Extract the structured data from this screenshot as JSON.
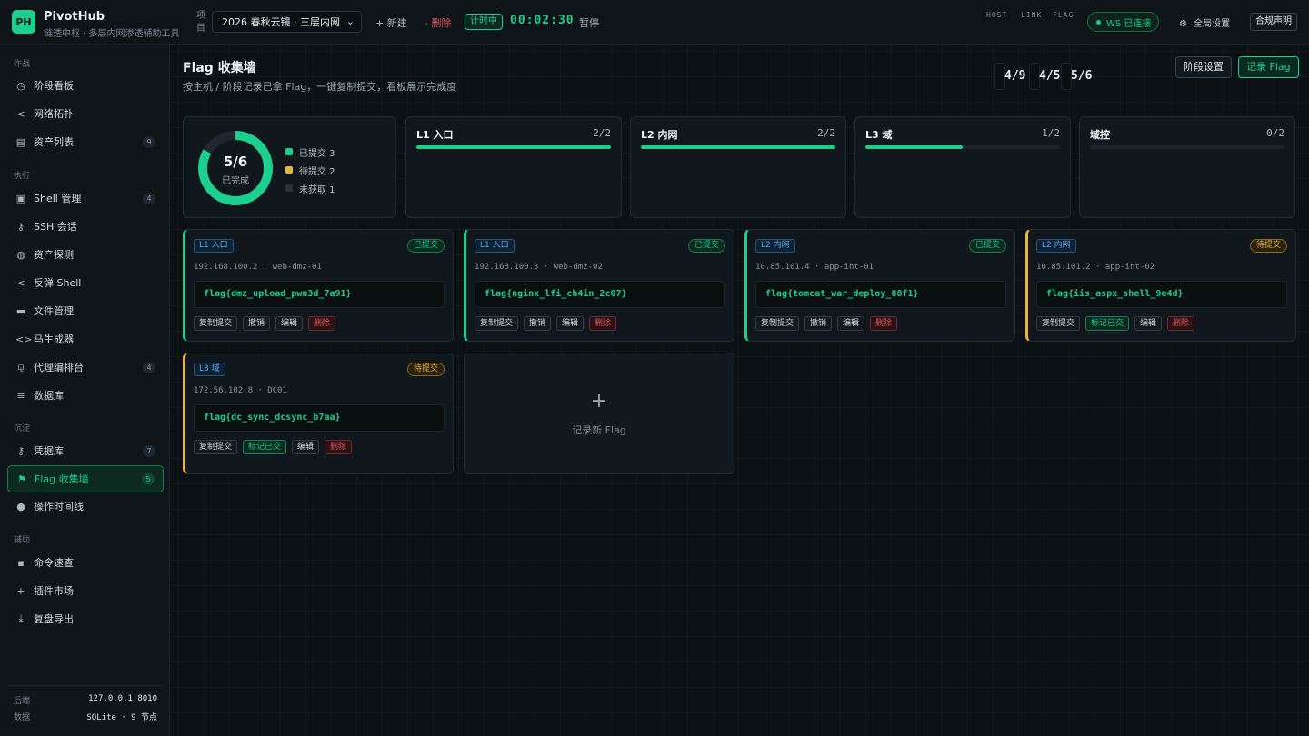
{
  "app": {
    "logo": "PH",
    "name": "PivotHub",
    "subtitle": "链透中枢 · 多层内网渗透辅助工具"
  },
  "topbar": {
    "project_label": "项目",
    "project_value": "2026 春秋云镜 · 三层内网",
    "new_label": "+ 新建",
    "delete_label": "- 删除",
    "timer_badge": "计时中",
    "timer_value": "00:02:30",
    "pause_label": "暂停",
    "stats": [
      {
        "label": "HOST",
        "value": "4/9"
      },
      {
        "label": "LINK",
        "value": "4/5"
      },
      {
        "label": "FLAG",
        "value": "5/6"
      }
    ],
    "ws_status": "WS 已连接",
    "global_settings": "全局设置",
    "compliance": "合规声明"
  },
  "sidebar": {
    "sections": [
      {
        "title": "作战",
        "items": [
          {
            "label": "阶段看板",
            "icon": "clock-icon"
          },
          {
            "label": "网络拓扑",
            "icon": "share-icon"
          },
          {
            "label": "资产列表",
            "icon": "server-icon",
            "count": "9"
          }
        ]
      },
      {
        "title": "执行",
        "items": [
          {
            "label": "Shell 管理",
            "icon": "terminal-icon",
            "count": "4"
          },
          {
            "label": "SSH 会话",
            "icon": "key-icon"
          },
          {
            "label": "资产探测",
            "icon": "globe-icon"
          },
          {
            "label": "反弹 Shell",
            "icon": "share-icon"
          },
          {
            "label": "文件管理",
            "icon": "folder-icon"
          },
          {
            "label": "马生成器",
            "icon": "code-icon"
          },
          {
            "label": "代理编排台",
            "icon": "sitemap-icon",
            "count": "4"
          },
          {
            "label": "数据库",
            "icon": "database-icon"
          }
        ]
      },
      {
        "title": "沉淀",
        "items": [
          {
            "label": "凭据库",
            "icon": "key-icon",
            "count": "7"
          },
          {
            "label": "Flag 收集墙",
            "icon": "flag-icon",
            "count": "5",
            "active": true
          },
          {
            "label": "操作时间线",
            "icon": "circle-icon"
          }
        ]
      },
      {
        "title": "辅助",
        "items": [
          {
            "label": "命令速查",
            "icon": "note-icon"
          },
          {
            "label": "插件市场",
            "icon": "plus-icon"
          },
          {
            "label": "复盘导出",
            "icon": "download-icon"
          }
        ]
      }
    ],
    "footer": {
      "backend_label": "后端",
      "backend_value": "127.0.0.1:8010",
      "data_label": "数据",
      "data_value": "SQLite · 9 节点"
    }
  },
  "main": {
    "title": "Flag 收集墙",
    "subtitle": "按主机 / 阶段记录已拿 Flag，一键复制提交，看板展示完成度",
    "btn_stage": "阶段设置",
    "btn_record": "记录 Flag",
    "summary": {
      "value": "5/6",
      "caption": "已完成",
      "legend": [
        {
          "label": "已提交 3",
          "color": "#1ccf8f"
        },
        {
          "label": "待提交 2",
          "color": "#e8b341"
        },
        {
          "label": "未获取 1",
          "color": "#2a343b"
        }
      ],
      "submitted": 3,
      "pending": 2,
      "missing": 1,
      "total": 6
    },
    "stages": [
      {
        "name": "L1 入口",
        "ratio": "2/2",
        "progress": 1.0
      },
      {
        "name": "L2 内网",
        "ratio": "2/2",
        "progress": 1.0
      },
      {
        "name": "L3 域",
        "ratio": "1/2",
        "progress": 0.5
      },
      {
        "name": "域控",
        "ratio": "0/2",
        "progress": 0
      }
    ],
    "flags": [
      {
        "level": "L1 入口",
        "status": "已提交",
        "state": "ok",
        "meta": "192.168.100.2 · web-dmz-01",
        "value": "flag{dmz_upload_pwn3d_7a91}",
        "actions": [
          "复制提交",
          "撤销",
          "编辑",
          "删除"
        ]
      },
      {
        "level": "L1 入口",
        "status": "已提交",
        "state": "ok",
        "meta": "192.168.100.3 · web-dmz-02",
        "value": "flag{nginx_lfi_ch4in_2c07}",
        "actions": [
          "复制提交",
          "撤销",
          "编辑",
          "删除"
        ]
      },
      {
        "level": "L2 内网",
        "status": "已提交",
        "state": "ok",
        "meta": "10.85.101.4 · app-int-01",
        "value": "flag{tomcat_war_deploy_88f1}",
        "actions": [
          "复制提交",
          "撤销",
          "编辑",
          "删除"
        ]
      },
      {
        "level": "L2 内网",
        "status": "待提交",
        "state": "pend",
        "meta": "10.85.101.2 · app-int-02",
        "value": "flag{iis_aspx_shell_9e4d}",
        "actions": [
          "复制提交",
          "标记已交",
          "编辑",
          "删除"
        ]
      },
      {
        "level": "L3 域",
        "status": "待提交",
        "state": "pend",
        "meta": "172.56.102.8 · DC01",
        "value": "flag{dc_sync_dcsync_b7aa}",
        "actions": [
          "复制提交",
          "标记已交",
          "编辑",
          "删除"
        ]
      }
    ],
    "new_flag": "记录新 Flag"
  }
}
